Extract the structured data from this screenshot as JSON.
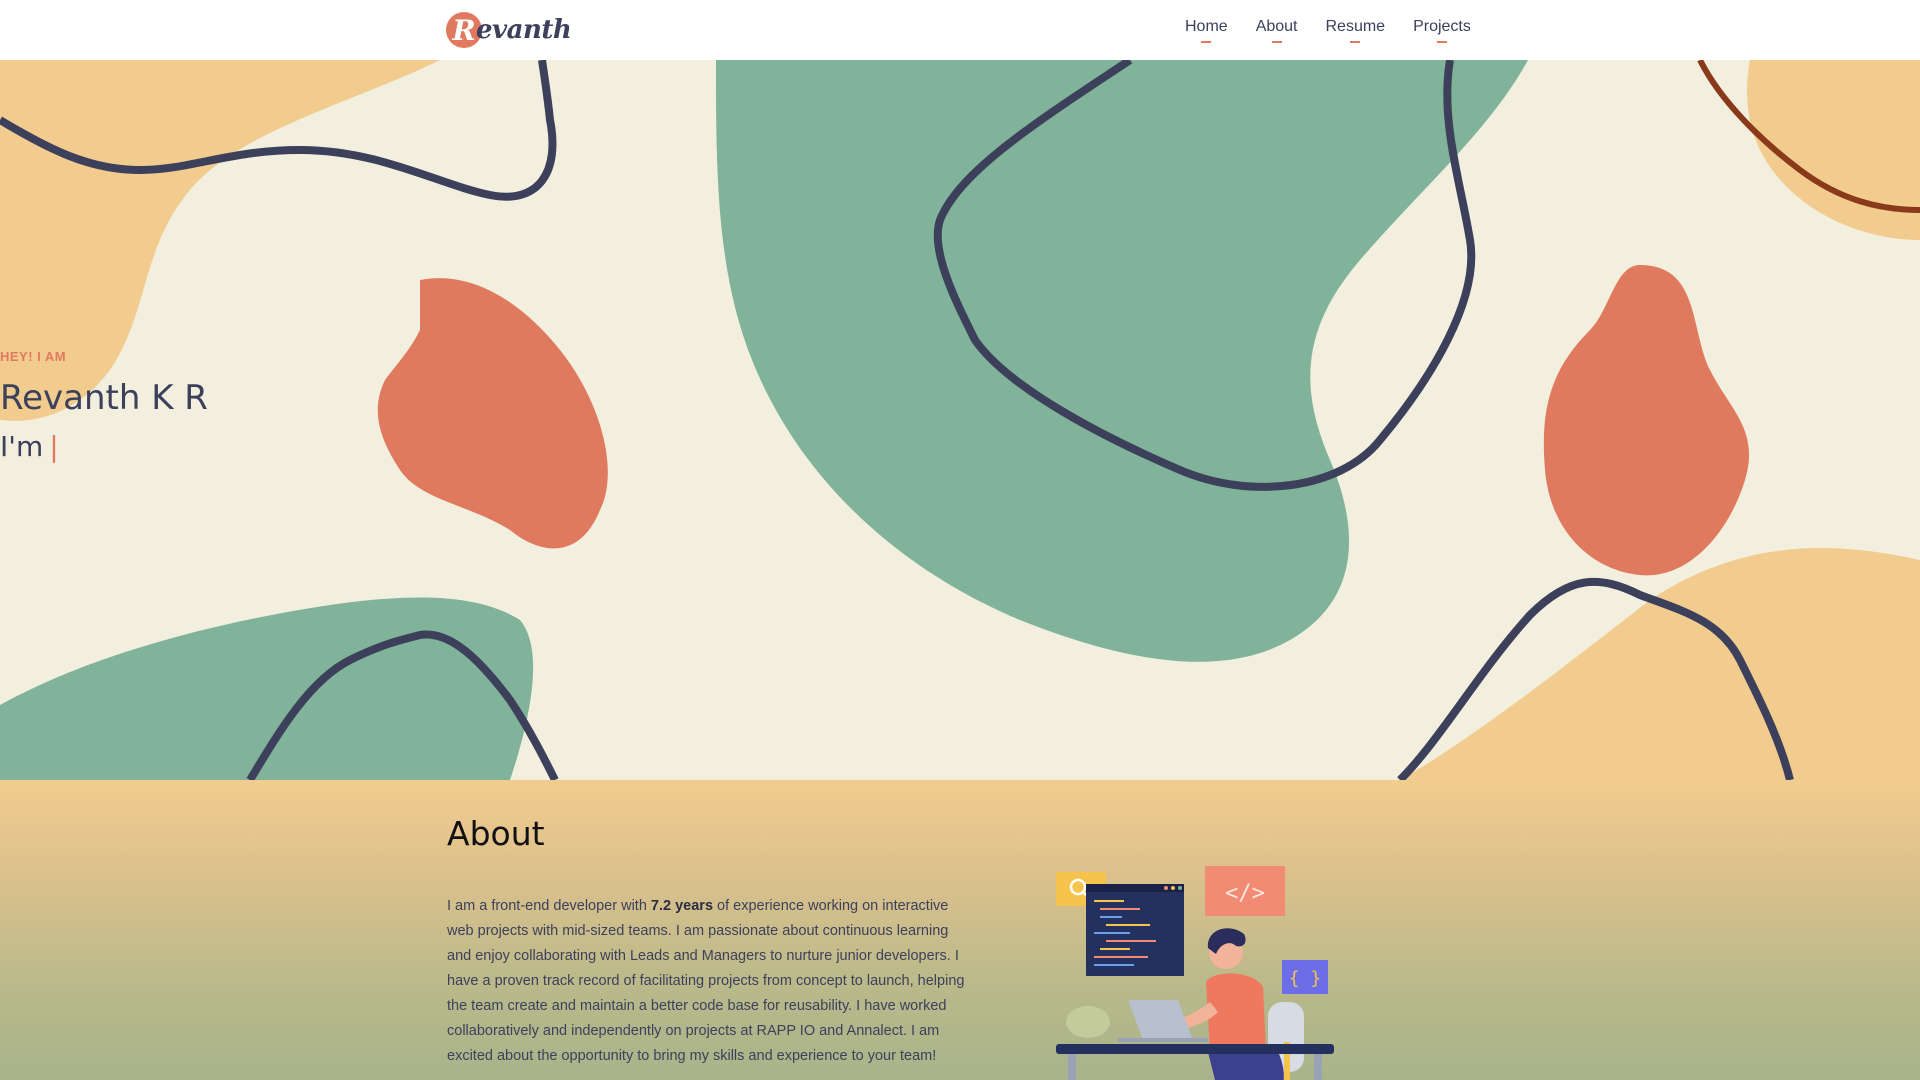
{
  "header": {
    "logo_initial": "R",
    "logo_text": "evanth",
    "nav": [
      {
        "label": "Home"
      },
      {
        "label": "About"
      },
      {
        "label": "Resume"
      },
      {
        "label": "Projects"
      }
    ]
  },
  "hero": {
    "eyebrow": "HEY! I AM",
    "name": "Revanth K R",
    "role_prefix": "I'm",
    "caret": "|"
  },
  "about": {
    "title": "About",
    "paragraph_part1": "I am a front-end developer with ",
    "years": "7.2 years",
    "paragraph_part2": " of experience working on interactive web projects with mid-sized teams. I am passionate about continuous learning and enjoy collaborating with Leads and Managers to nurture junior developers. I have a proven track record of facilitating projects from concept to launch, helping the team create and maintain a better code base for reusability. I have worked collaboratively and independently on projects at RAPP IO and Annalect. I am excited about the opportunity to bring my skills and experience to your team!",
    "illustration": {
      "search_icon": "search-icon",
      "code_tag": "</>",
      "braces": "{ }"
    }
  },
  "colors": {
    "cream": "#f3efdf",
    "sand": "#f2cc8f",
    "sage": "#81b29a",
    "coral": "#e07a5f",
    "navy": "#3d405b",
    "rust": "#8a3a1a"
  }
}
